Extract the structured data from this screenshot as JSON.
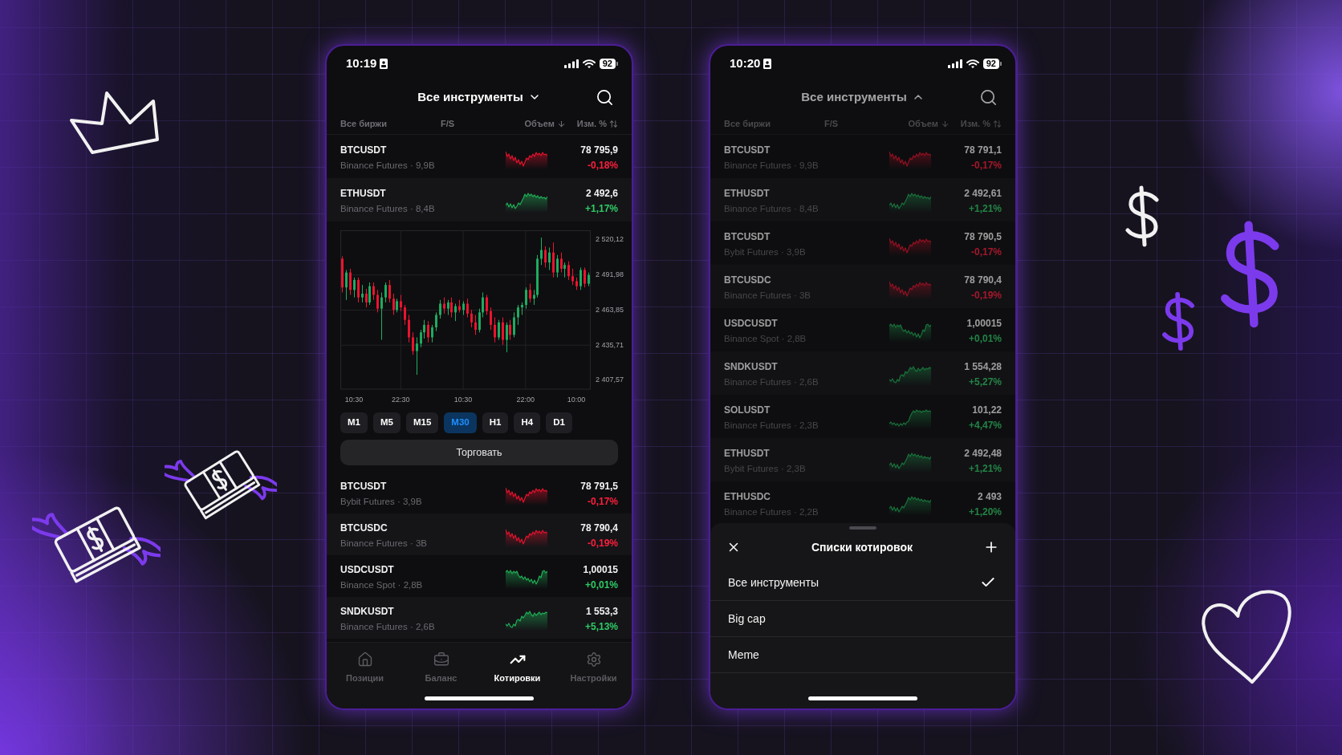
{
  "phones": [
    {
      "status_bar": {
        "time": "10:19",
        "battery": "92"
      },
      "header": {
        "title": "Все инструменты",
        "expanded": false
      },
      "dimmed": false,
      "columns": [
        {
          "label": "Все биржи"
        },
        {
          "label": "F/S"
        },
        {
          "label": "Объем",
          "sorted": true
        },
        {
          "label": "Изм. %",
          "sorted": false
        }
      ],
      "rows": [
        {
          "symbol": "BTCUSDT",
          "market": "Binance Futures · 9,9B",
          "price": "78 795,9",
          "change": "-0,18%",
          "rising": false
        },
        {
          "symbol": "ETHUSDT",
          "market": "Binance Futures · 8,4B",
          "price": "2 492,6",
          "change": "+1,17%",
          "rising": true
        }
      ],
      "chart_data": {
        "type": "candlestick",
        "grid": true,
        "categories": [
          null,
          null,
          null,
          "10:30",
          null,
          null,
          null,
          null,
          null,
          null,
          null,
          null,
          null,
          null,
          null,
          "22:30",
          null,
          null,
          null,
          null,
          null,
          null,
          null,
          null,
          null,
          null,
          null,
          null,
          null,
          null,
          null,
          "10:30",
          null,
          null,
          null,
          null,
          null,
          null,
          null,
          null,
          null,
          null,
          null,
          null,
          null,
          null,
          null,
          "22:00",
          null,
          null,
          null,
          null,
          null,
          null,
          null,
          null,
          null,
          null,
          null,
          null,
          "10:00",
          null,
          null,
          null
        ],
        "ohlc": [
          [
            2505,
            2507,
            2478,
            2482
          ],
          [
            2482,
            2496,
            2472,
            2494
          ],
          [
            2494,
            2497,
            2476,
            2480
          ],
          [
            2480,
            2490,
            2474,
            2488
          ],
          [
            2488,
            2490,
            2470,
            2474
          ],
          [
            2474,
            2484,
            2470,
            2477
          ],
          [
            2477,
            2481,
            2466,
            2470
          ],
          [
            2470,
            2486,
            2468,
            2483
          ],
          [
            2483,
            2486,
            2472,
            2476
          ],
          [
            2476,
            2480,
            2462,
            2465
          ],
          [
            2465,
            2478,
            2440,
            2474
          ],
          [
            2474,
            2486,
            2470,
            2484
          ],
          [
            2484,
            2488,
            2470,
            2473
          ],
          [
            2473,
            2477,
            2460,
            2464
          ],
          [
            2464,
            2473,
            2462,
            2471
          ],
          [
            2471,
            2476,
            2463,
            2466
          ],
          [
            2466,
            2468,
            2452,
            2456
          ],
          [
            2456,
            2460,
            2438,
            2442
          ],
          [
            2442,
            2446,
            2428,
            2431
          ],
          [
            2431,
            2442,
            2412,
            2437
          ],
          [
            2437,
            2448,
            2434,
            2446
          ],
          [
            2446,
            2456,
            2441,
            2452
          ],
          [
            2452,
            2455,
            2438,
            2442
          ],
          [
            2442,
            2452,
            2438,
            2450
          ],
          [
            2450,
            2462,
            2447,
            2460
          ],
          [
            2460,
            2472,
            2457,
            2469
          ],
          [
            2469,
            2474,
            2461,
            2465
          ],
          [
            2465,
            2472,
            2460,
            2470
          ],
          [
            2470,
            2474,
            2458,
            2462
          ],
          [
            2462,
            2469,
            2455,
            2467
          ],
          [
            2467,
            2472,
            2462,
            2464
          ],
          [
            2464,
            2471,
            2460,
            2469
          ],
          [
            2469,
            2473,
            2458,
            2461
          ],
          [
            2461,
            2464,
            2450,
            2454
          ],
          [
            2454,
            2460,
            2444,
            2448
          ],
          [
            2448,
            2465,
            2446,
            2462
          ],
          [
            2462,
            2478,
            2458,
            2474
          ],
          [
            2474,
            2476,
            2460,
            2463
          ],
          [
            2463,
            2466,
            2448,
            2452
          ],
          [
            2452,
            2458,
            2438,
            2442
          ],
          [
            2442,
            2456,
            2440,
            2454
          ],
          [
            2454,
            2458,
            2436,
            2440
          ],
          [
            2440,
            2454,
            2430,
            2452
          ],
          [
            2452,
            2456,
            2440,
            2444
          ],
          [
            2444,
            2462,
            2442,
            2458
          ],
          [
            2458,
            2468,
            2452,
            2466
          ],
          [
            2466,
            2470,
            2460,
            2468
          ],
          [
            2468,
            2482,
            2465,
            2480
          ],
          [
            2480,
            2485,
            2470,
            2473
          ],
          [
            2473,
            2480,
            2468,
            2476
          ],
          [
            2476,
            2508,
            2474,
            2505
          ],
          [
            2505,
            2522,
            2500,
            2512
          ],
          [
            2512,
            2515,
            2498,
            2502
          ],
          [
            2502,
            2514,
            2496,
            2510
          ],
          [
            2510,
            2518,
            2490,
            2494
          ],
          [
            2494,
            2508,
            2490,
            2505
          ],
          [
            2505,
            2510,
            2494,
            2497
          ],
          [
            2497,
            2502,
            2490,
            2500
          ],
          [
            2500,
            2503,
            2488,
            2491
          ],
          [
            2491,
            2497,
            2484,
            2487
          ],
          [
            2487,
            2490,
            2480,
            2483
          ],
          [
            2483,
            2498,
            2480,
            2496
          ],
          [
            2496,
            2498,
            2482,
            2485
          ],
          [
            2485,
            2494,
            2483,
            2492
          ]
        ],
        "ylim": [
          2400.5,
          2527.5
        ],
        "yticks": [
          {
            "value": 2520.12,
            "label": "2 520,12"
          },
          {
            "value": 2491.98,
            "label": "2 491,98"
          },
          {
            "value": 2463.85,
            "label": "2 463,85"
          },
          {
            "value": 2435.71,
            "label": "2 435,71"
          },
          {
            "value": 2407.57,
            "label": "2 407,57"
          }
        ]
      },
      "timeframes": [
        {
          "label": "M1",
          "selected": false
        },
        {
          "label": "M5",
          "selected": false
        },
        {
          "label": "M15",
          "selected": false
        },
        {
          "label": "M30",
          "selected": true
        },
        {
          "label": "H1",
          "selected": false
        },
        {
          "label": "H4",
          "selected": false
        },
        {
          "label": "D1",
          "selected": false
        }
      ],
      "trade_button": "Торговать",
      "rows_after_chart": [
        {
          "symbol": "BTCUSDT",
          "market": "Bybit Futures · 3,9B",
          "price": "78 791,5",
          "change": "-0,17%",
          "rising": false
        },
        {
          "symbol": "BTCUSDC",
          "market": "Binance Futures · 3B",
          "price": "78 790,4",
          "change": "-0,19%",
          "rising": false
        },
        {
          "symbol": "USDCUSDT",
          "market": "Binance Spot · 2,8B",
          "price": "1,00015",
          "change": "+0,01%",
          "rising": true
        },
        {
          "symbol": "SNDKUSDT",
          "market": "Binance Futures · 2,6B",
          "price": "1 553,3",
          "change": "+5,13%",
          "rising": true
        }
      ],
      "tab_bar": [
        {
          "label": "Позиции",
          "selected": false
        },
        {
          "label": "Баланс",
          "selected": false
        },
        {
          "label": "Котировки",
          "selected": true
        },
        {
          "label": "Настройки",
          "selected": false
        }
      ]
    },
    {
      "status_bar": {
        "time": "10:20",
        "battery": "92"
      },
      "header": {
        "title": "Все инструменты",
        "expanded": true
      },
      "dimmed": true,
      "columns": [
        {
          "label": "Все биржи"
        },
        {
          "label": "F/S"
        },
        {
          "label": "Объем",
          "sorted": true
        },
        {
          "label": "Изм. %",
          "sorted": false
        }
      ],
      "rows": [
        {
          "symbol": "BTCUSDT",
          "market": "Binance Futures · 9,9B",
          "price": "78 791,1",
          "change": "-0,17%",
          "rising": false
        },
        {
          "symbol": "ETHUSDT",
          "market": "Binance Futures · 8,4B",
          "price": "2 492,61",
          "change": "+1,21%",
          "rising": true
        },
        {
          "symbol": "BTCUSDT",
          "market": "Bybit Futures · 3,9B",
          "price": "78 790,5",
          "change": "-0,17%",
          "rising": false
        },
        {
          "symbol": "BTCUSDC",
          "market": "Binance Futures · 3B",
          "price": "78 790,4",
          "change": "-0,19%",
          "rising": false
        },
        {
          "symbol": "USDCUSDT",
          "market": "Binance Spot · 2,8B",
          "price": "1,00015",
          "change": "+0,01%",
          "rising": true
        },
        {
          "symbol": "SNDKUSDT",
          "market": "Binance Futures · 2,6B",
          "price": "1 554,28",
          "change": "+5,27%",
          "rising": true
        },
        {
          "symbol": "SOLUSDT",
          "market": "Binance Futures · 2,3B",
          "price": "101,22",
          "change": "+4,47%",
          "rising": true
        },
        {
          "symbol": "ETHUSDT",
          "market": "Bybit Futures · 2,3B",
          "price": "2 492,48",
          "change": "+1,21%",
          "rising": true
        },
        {
          "symbol": "ETHUSDC",
          "market": "Binance Futures · 2,2B",
          "price": "2 493",
          "change": "+1,20%",
          "rising": true
        }
      ],
      "sheet": {
        "title": "Списки котировок",
        "lists": [
          {
            "label": "Все инструменты",
            "selected": true
          },
          {
            "label": "Big cap",
            "selected": false
          },
          {
            "label": "Meme",
            "selected": false
          }
        ]
      }
    }
  ]
}
